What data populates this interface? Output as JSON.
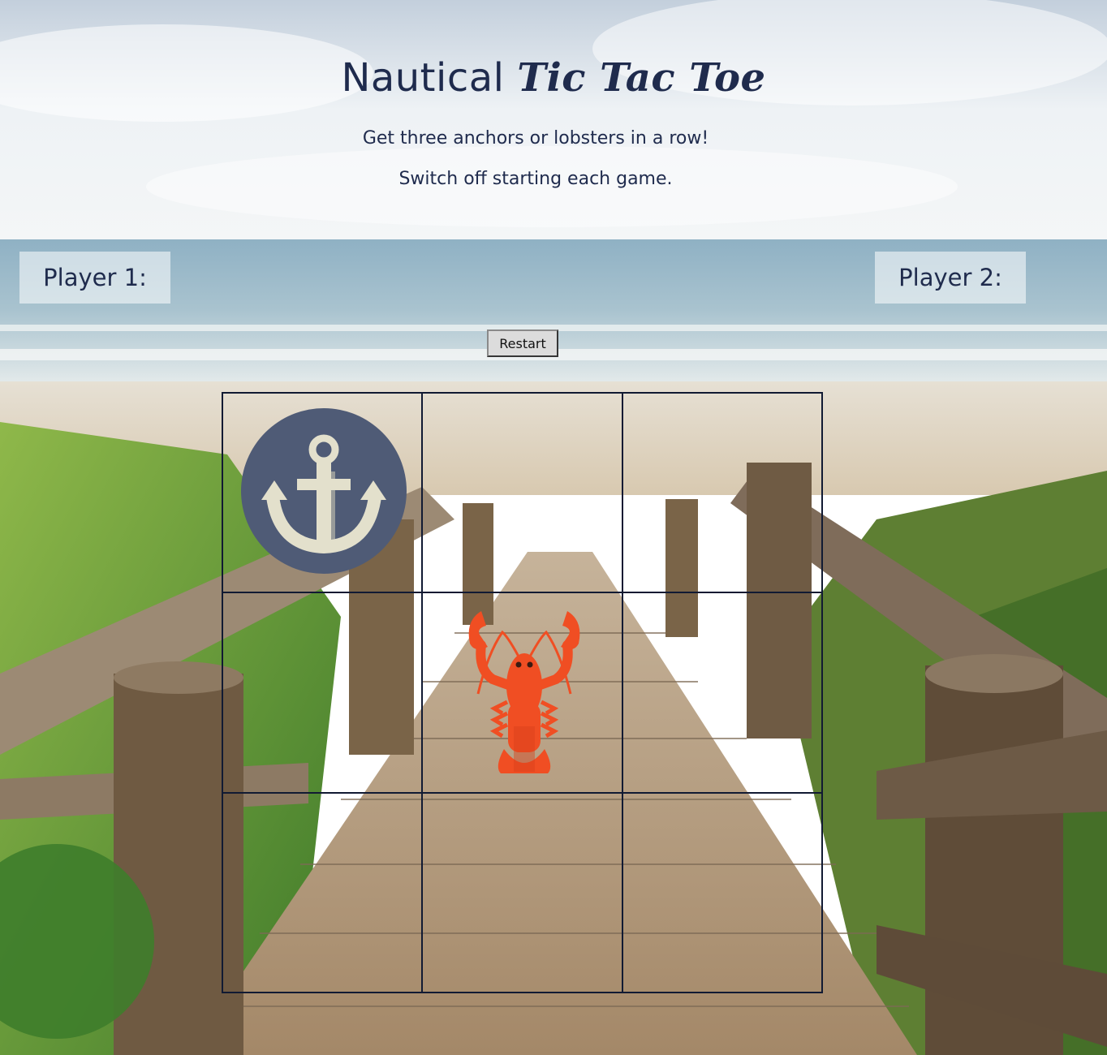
{
  "header": {
    "title_plain": "Nautical ",
    "title_script": "Tic Tac Toe",
    "subtitle_1": "Get three anchors or lobsters in a row!",
    "subtitle_2": "Switch off starting each game."
  },
  "players": {
    "p1_label": "Player 1:",
    "p2_label": "Player 2:"
  },
  "controls": {
    "restart_label": "Restart"
  },
  "board": {
    "cells": [
      "anchor",
      "",
      "",
      "",
      "lobster",
      "",
      "",
      "",
      ""
    ]
  },
  "colors": {
    "text": "#1f2b4d",
    "anchor_bg": "#4f5b76",
    "anchor_fg": "#e3e0cc",
    "lobster": "#f04e23",
    "grid": "#111a33"
  }
}
